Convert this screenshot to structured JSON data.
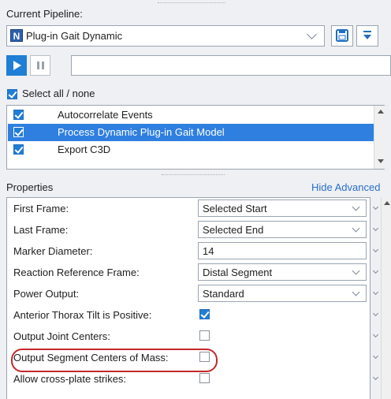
{
  "pipeline": {
    "label": "Current Pipeline:",
    "name": "Plug-in Gait Dynamic",
    "logo_letter": "N"
  },
  "select_all": {
    "label": "Select all / none",
    "checked": true
  },
  "operations": [
    {
      "label": "Autocorrelate Events",
      "checked": true,
      "selected": false
    },
    {
      "label": "Process Dynamic Plug-in Gait Model",
      "checked": true,
      "selected": true
    },
    {
      "label": "Export C3D",
      "checked": true,
      "selected": false
    }
  ],
  "properties": {
    "title": "Properties",
    "advanced_link": "Hide Advanced",
    "rows": [
      {
        "name": "First Frame:",
        "type": "combo",
        "value": "Selected Start"
      },
      {
        "name": "Last Frame:",
        "type": "combo",
        "value": "Selected End"
      },
      {
        "name": "Marker Diameter:",
        "type": "input",
        "value": "14"
      },
      {
        "name": "Reaction Reference Frame:",
        "type": "combo",
        "value": "Distal Segment"
      },
      {
        "name": "Power Output:",
        "type": "combo",
        "value": "Standard"
      },
      {
        "name": "Anterior Thorax Tilt is Positive:",
        "type": "checkbox",
        "checked": true
      },
      {
        "name": "Output Joint Centers:",
        "type": "checkbox",
        "checked": false
      },
      {
        "name": "Output Segment Centers of Mass:",
        "type": "checkbox",
        "checked": false
      },
      {
        "name": "Allow cross-plate strikes:",
        "type": "checkbox",
        "checked": false
      }
    ]
  },
  "colors": {
    "accent": "#2f7fe0",
    "highlight_ring": "#c5282d"
  }
}
